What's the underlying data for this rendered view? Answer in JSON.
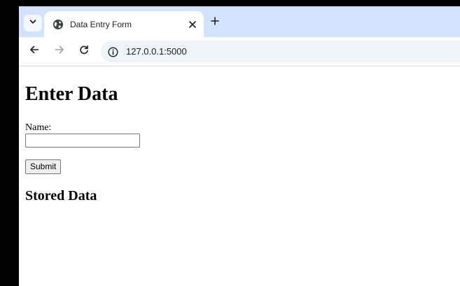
{
  "browser": {
    "tab": {
      "title": "Data Entry Form",
      "favicon": "globe-icon"
    },
    "address_bar": {
      "url": "127.0.0.1:5000"
    },
    "colors": {
      "tabstrip": "#d3e3fd",
      "omnibox": "#eff3fa"
    }
  },
  "page": {
    "heading": "Enter Data",
    "form": {
      "name_label": "Name:",
      "name_value": "",
      "submit_label": "Submit"
    },
    "stored_heading": "Stored Data"
  }
}
